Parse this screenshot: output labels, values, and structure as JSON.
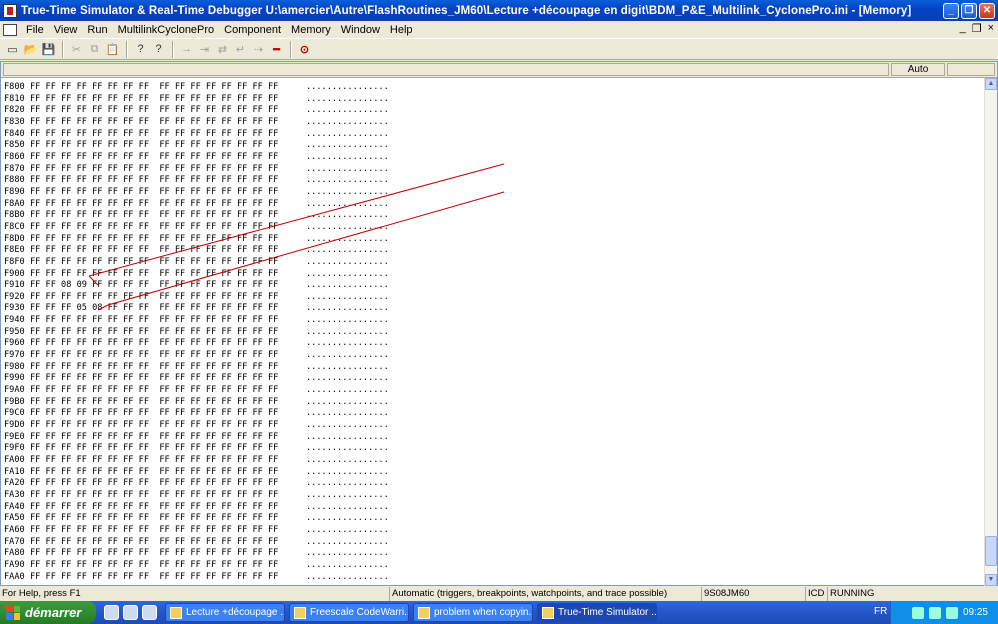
{
  "window": {
    "title": "True-Time Simulator & Real-Time Debugger   U:\\amercier\\Autre\\FlashRoutines_JM60\\Lecture +découpage en digit\\BDM_P&E_Multilink_CyclonePro.ini - [Memory]",
    "minimize": "_",
    "maximize": "❐",
    "close": "✕"
  },
  "menu": {
    "items": [
      "File",
      "View",
      "Run",
      "MultilinkCyclonePro",
      "Component",
      "Memory",
      "Window",
      "Help"
    ],
    "mdi": [
      "_",
      "❐",
      "×"
    ]
  },
  "toolbar": {
    "icons": [
      "new-icon",
      "open-icon",
      "save-icon",
      "cut-icon",
      "copy-icon",
      "paste-icon",
      "help-icon",
      "context-help-icon",
      "step-in-icon",
      "step-over-icon",
      "step-out-icon",
      "assembly-step-icon",
      "run-icon",
      "halt-icon",
      "reset-icon"
    ]
  },
  "memory": {
    "mode": "Auto",
    "rows": [
      {
        "addr": "F800",
        "bytes": "FF FF FF FF FF FF FF FF  FF FF FF FF FF FF FF FF",
        "ascii": "................"
      },
      {
        "addr": "F810",
        "bytes": "FF FF FF FF FF FF FF FF  FF FF FF FF FF FF FF FF",
        "ascii": "................"
      },
      {
        "addr": "F820",
        "bytes": "FF FF FF FF FF FF FF FF  FF FF FF FF FF FF FF FF",
        "ascii": "................"
      },
      {
        "addr": "F830",
        "bytes": "FF FF FF FF FF FF FF FF  FF FF FF FF FF FF FF FF",
        "ascii": "................"
      },
      {
        "addr": "F840",
        "bytes": "FF FF FF FF FF FF FF FF  FF FF FF FF FF FF FF FF",
        "ascii": "................"
      },
      {
        "addr": "F850",
        "bytes": "FF FF FF FF FF FF FF FF  FF FF FF FF FF FF FF FF",
        "ascii": "................"
      },
      {
        "addr": "F860",
        "bytes": "FF FF FF FF FF FF FF FF  FF FF FF FF FF FF FF FF",
        "ascii": "................"
      },
      {
        "addr": "F870",
        "bytes": "FF FF FF FF FF FF FF FF  FF FF FF FF FF FF FF FF",
        "ascii": "................"
      },
      {
        "addr": "F880",
        "bytes": "FF FF FF FF FF FF FF FF  FF FF FF FF FF FF FF FF",
        "ascii": "................"
      },
      {
        "addr": "F890",
        "bytes": "FF FF FF FF FF FF FF FF  FF FF FF FF FF FF FF FF",
        "ascii": "................"
      },
      {
        "addr": "F8A0",
        "bytes": "FF FF FF FF FF FF FF FF  FF FF FF FF FF FF FF FF",
        "ascii": "................"
      },
      {
        "addr": "F8B0",
        "bytes": "FF FF FF FF FF FF FF FF  FF FF FF FF FF FF FF FF",
        "ascii": "................"
      },
      {
        "addr": "F8C0",
        "bytes": "FF FF FF FF FF FF FF FF  FF FF FF FF FF FF FF FF",
        "ascii": "................"
      },
      {
        "addr": "F8D0",
        "bytes": "FF FF FF FF FF FF FF FF  FF FF FF FF FF FF FF FF",
        "ascii": "................"
      },
      {
        "addr": "F8E0",
        "bytes": "FF FF FF FF FF FF FF FF  FF FF FF FF FF FF FF FF",
        "ascii": "................"
      },
      {
        "addr": "F8F0",
        "bytes": "FF FF FF FF FF FF FF FF  FF FF FF FF FF FF FF FF",
        "ascii": "................"
      },
      {
        "addr": "F900",
        "bytes": "FF FF FF FF FF FF FF FF  FF FF FF FF FF FF FF FF",
        "ascii": "................"
      },
      {
        "addr": "F910",
        "bytes": "FF FF 08 09 FF FF FF FF  FF FF FF FF FF FF FF FF",
        "ascii": "................"
      },
      {
        "addr": "F920",
        "bytes": "FF FF FF FF FF FF FF FF  FF FF FF FF FF FF FF FF",
        "ascii": "................"
      },
      {
        "addr": "F930",
        "bytes": "FF FF FF 05 08 FF FF FF  FF FF FF FF FF FF FF FF",
        "ascii": "................"
      },
      {
        "addr": "F940",
        "bytes": "FF FF FF FF FF FF FF FF  FF FF FF FF FF FF FF FF",
        "ascii": "................"
      },
      {
        "addr": "F950",
        "bytes": "FF FF FF FF FF FF FF FF  FF FF FF FF FF FF FF FF",
        "ascii": "................"
      },
      {
        "addr": "F960",
        "bytes": "FF FF FF FF FF FF FF FF  FF FF FF FF FF FF FF FF",
        "ascii": "................"
      },
      {
        "addr": "F970",
        "bytes": "FF FF FF FF FF FF FF FF  FF FF FF FF FF FF FF FF",
        "ascii": "................"
      },
      {
        "addr": "F980",
        "bytes": "FF FF FF FF FF FF FF FF  FF FF FF FF FF FF FF FF",
        "ascii": "................"
      },
      {
        "addr": "F990",
        "bytes": "FF FF FF FF FF FF FF FF  FF FF FF FF FF FF FF FF",
        "ascii": "................"
      },
      {
        "addr": "F9A0",
        "bytes": "FF FF FF FF FF FF FF FF  FF FF FF FF FF FF FF FF",
        "ascii": "................"
      },
      {
        "addr": "F9B0",
        "bytes": "FF FF FF FF FF FF FF FF  FF FF FF FF FF FF FF FF",
        "ascii": "................"
      },
      {
        "addr": "F9C0",
        "bytes": "FF FF FF FF FF FF FF FF  FF FF FF FF FF FF FF FF",
        "ascii": "................"
      },
      {
        "addr": "F9D0",
        "bytes": "FF FF FF FF FF FF FF FF  FF FF FF FF FF FF FF FF",
        "ascii": "................"
      },
      {
        "addr": "F9E0",
        "bytes": "FF FF FF FF FF FF FF FF  FF FF FF FF FF FF FF FF",
        "ascii": "................"
      },
      {
        "addr": "F9F0",
        "bytes": "FF FF FF FF FF FF FF FF  FF FF FF FF FF FF FF FF",
        "ascii": "................"
      },
      {
        "addr": "FA00",
        "bytes": "FF FF FF FF FF FF FF FF  FF FF FF FF FF FF FF FF",
        "ascii": "................"
      },
      {
        "addr": "FA10",
        "bytes": "FF FF FF FF FF FF FF FF  FF FF FF FF FF FF FF FF",
        "ascii": "................"
      },
      {
        "addr": "FA20",
        "bytes": "FF FF FF FF FF FF FF FF  FF FF FF FF FF FF FF FF",
        "ascii": "................"
      },
      {
        "addr": "FA30",
        "bytes": "FF FF FF FF FF FF FF FF  FF FF FF FF FF FF FF FF",
        "ascii": "................"
      },
      {
        "addr": "FA40",
        "bytes": "FF FF FF FF FF FF FF FF  FF FF FF FF FF FF FF FF",
        "ascii": "................"
      },
      {
        "addr": "FA50",
        "bytes": "FF FF FF FF FF FF FF FF  FF FF FF FF FF FF FF FF",
        "ascii": "................"
      },
      {
        "addr": "FA60",
        "bytes": "FF FF FF FF FF FF FF FF  FF FF FF FF FF FF FF FF",
        "ascii": "................"
      },
      {
        "addr": "FA70",
        "bytes": "FF FF FF FF FF FF FF FF  FF FF FF FF FF FF FF FF",
        "ascii": "................"
      },
      {
        "addr": "FA80",
        "bytes": "FF FF FF FF FF FF FF FF  FF FF FF FF FF FF FF FF",
        "ascii": "................"
      },
      {
        "addr": "FA90",
        "bytes": "FF FF FF FF FF FF FF FF  FF FF FF FF FF FF FF FF",
        "ascii": "................"
      },
      {
        "addr": "FAA0",
        "bytes": "FF FF FF FF FF FF FF FF  FF FF FF FF FF FF FF FF",
        "ascii": "................"
      }
    ],
    "annotation_color": "#C00000"
  },
  "status": {
    "help": "For Help, press F1",
    "mode": "Automatic (triggers, breakpoints, watchpoints, and trace possible)",
    "cpu": "9S08JM60",
    "conn": "ICD",
    "state": "RUNNING"
  },
  "taskbar": {
    "start": "démarrer",
    "tasks": [
      {
        "label": "Lecture +découpage ...",
        "active": false
      },
      {
        "label": "Freescale CodeWarri...",
        "active": false
      },
      {
        "label": "problem when copyin...",
        "active": false
      },
      {
        "label": "True-Time Simulator ...",
        "active": true
      }
    ],
    "lang": "FR",
    "clock": "09:25"
  }
}
